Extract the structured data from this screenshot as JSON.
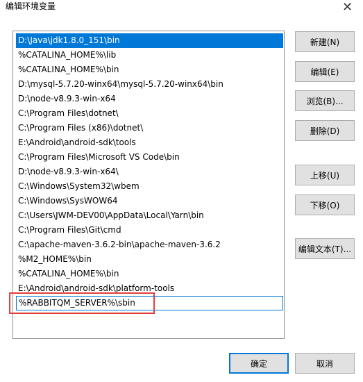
{
  "window": {
    "title": "编辑环境变量",
    "close_glyph": "✕"
  },
  "entries": [
    "D:\\Java\\jdk1.8.0_151\\bin",
    "%CATALINA_HOME%\\lib",
    "%CATALINA_HOME%\\bin",
    "D:\\mysql-5.7.20-winx64\\mysql-5.7.20-winx64\\bin",
    "D:\\node-v8.9.3-win-x64",
    "C:\\Program Files\\dotnet\\",
    "C:\\Program Files (x86)\\dotnet\\",
    "E:\\Android\\android-sdk\\tools",
    "C:\\Program Files\\Microsoft VS Code\\bin",
    "D:\\node-v8.9.3-win-x64\\",
    "C:\\Windows\\System32\\wbem",
    "C:\\Windows\\SysWOW64",
    "C:\\Users\\JWM-DEV00\\AppData\\Local\\Yarn\\bin",
    "C:\\Program Files\\Git\\cmd",
    "C:\\apache-maven-3.6.2-bin\\apache-maven-3.6.2",
    "%M2_HOME%\\bin",
    "%CATALINA_HOME%\\bin",
    "E:\\Android\\android-sdk\\platform-tools",
    "%RABBITQM_SERVER%\\sbin"
  ],
  "selected_index": 0,
  "editing_index": 18,
  "buttons": {
    "new": "新建(N)",
    "edit": "编辑(E)",
    "browse": "浏览(B)...",
    "delete": "删除(D)",
    "move_up": "上移(U)",
    "move_down": "下移(O)",
    "edit_text": "编辑文本(T)...",
    "ok": "确定",
    "cancel": "取消"
  },
  "colors": {
    "selection": "#0078d7",
    "annotation_box": "#e0403a"
  }
}
